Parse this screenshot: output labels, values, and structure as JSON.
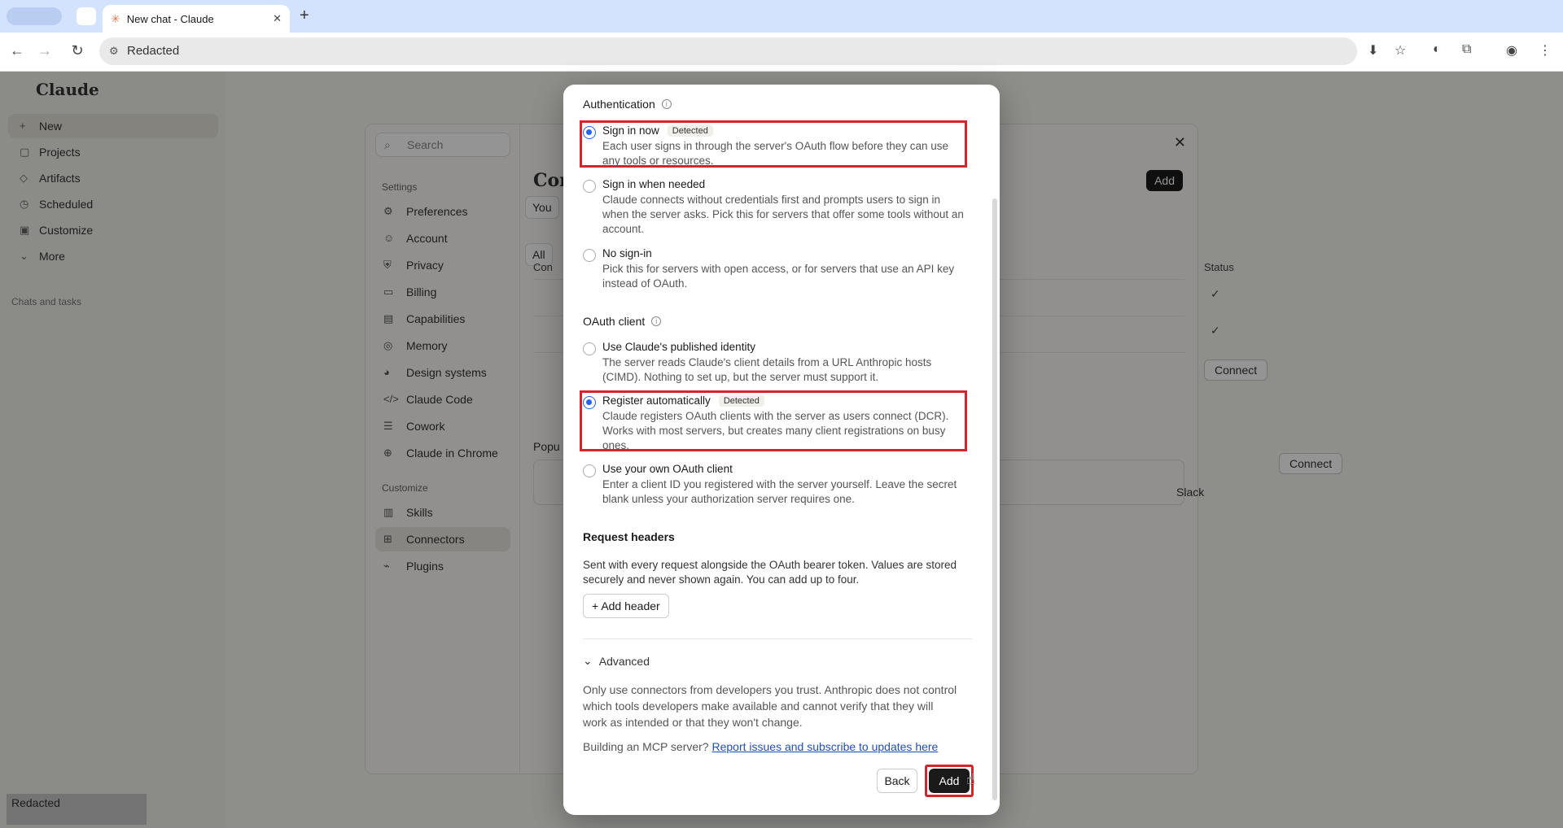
{
  "browser": {
    "tab_title": "New chat - Claude",
    "address": "Redacted"
  },
  "app": {
    "brand": "Claude",
    "sidebar_items": [
      "New",
      "Projects",
      "Artifacts",
      "Scheduled",
      "Customize",
      "More"
    ],
    "sidebar_section": "Chats and tasks",
    "bottom_user": "Redacted"
  },
  "settings": {
    "search_placeholder": "Search",
    "settings_heading": "Settings",
    "settings_items": [
      "Preferences",
      "Account",
      "Privacy",
      "Billing",
      "Capabilities",
      "Memory",
      "Design systems",
      "Claude Code",
      "Cowork",
      "Claude in Chrome"
    ],
    "customize_heading": "Customize",
    "customize_items": [
      "Skills",
      "Connectors",
      "Plugins"
    ],
    "active_item": "Connectors",
    "partial_title": "Con",
    "add_label": "Add",
    "chip_you": "You",
    "chip_all": "All",
    "col_con": "Con",
    "status_header": "Status",
    "connect_label": "Connect",
    "popular_label": "Popu",
    "slack_label": "Slack"
  },
  "modal": {
    "auth_title": "Authentication",
    "auth_options": [
      {
        "label": "Sign in now",
        "badge": "Detected",
        "desc": "Each user signs in through the server's OAuth flow before they can use any tools or resources.",
        "selected": true
      },
      {
        "label": "Sign in when needed",
        "badge": "",
        "desc": "Claude connects without credentials first and prompts users to sign in when the server asks. Pick this for servers that offer some tools without an account.",
        "selected": false
      },
      {
        "label": "No sign-in",
        "badge": "",
        "desc": "Pick this for servers with open access, or for servers that use an API key instead of OAuth.",
        "selected": false
      }
    ],
    "oauth_title": "OAuth client",
    "oauth_options": [
      {
        "label": "Use Claude's published identity",
        "badge": "",
        "desc": "The server reads Claude's client details from a URL Anthropic hosts (CIMD). Nothing to set up, but the server must support it.",
        "selected": false
      },
      {
        "label": "Register automatically",
        "badge": "Detected",
        "desc": "Claude registers OAuth clients with the server as users connect (DCR). Works with most servers, but creates many client registrations on busy ones.",
        "selected": true
      },
      {
        "label": "Use your own OAuth client",
        "badge": "",
        "desc": "Enter a client ID you registered with the server yourself. Leave the secret blank unless your authorization server requires one.",
        "selected": false
      }
    ],
    "request_headers_title": "Request headers",
    "request_headers_desc": "Sent with every request alongside the OAuth bearer token. Values are stored securely and never shown again. You can add up to four.",
    "add_header_label": "Add header",
    "advanced_label": "Advanced",
    "trust_notice": "Only use connectors from developers you trust. Anthropic does not control which tools developers make available and cannot verify that they will work as intended or that they won't change.",
    "mcp_prefix": "Building an MCP server?",
    "mcp_link": "Report issues and subscribe to updates here",
    "back_label": "Back",
    "add_label": "Add"
  },
  "colors": {
    "accent": "#2563eb",
    "highlight": "#d4242c",
    "primary_button": "#1a1a1a"
  }
}
